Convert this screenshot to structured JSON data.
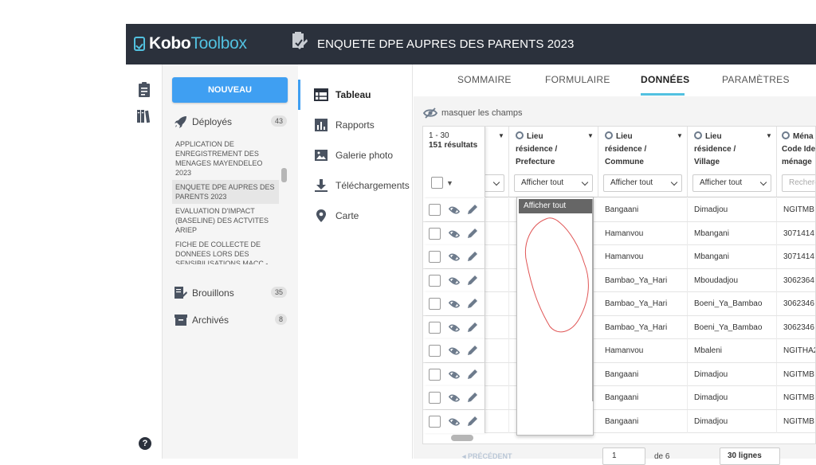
{
  "header": {
    "logo_kobo": "Kobo",
    "logo_toolbox": "Toolbox",
    "form_title": "ENQUETE  DPE AUPRES DES PARENTS 2023"
  },
  "sidebar": {
    "new_button": "NOUVEAU",
    "deployed": {
      "label": "Déployés",
      "count": "43"
    },
    "projects": [
      "APPLICATION DE ENREGISTREMENT DES MENAGES MAYENDELEO 2023",
      "ENQUETE DPE AUPRES DES PARENTS 2023",
      "EVALUATION D'IMPACT (BASELINE) DES ACTVITES ARIEP",
      "FICHE DE COLLECTE DE DONNEES LORS DES SENSIBILISATIONS MACC - ..."
    ],
    "drafts": {
      "label": "Brouillons",
      "count": "35"
    },
    "archived": {
      "label": "Archivés",
      "count": "8"
    }
  },
  "subnav": {
    "table": "Tableau",
    "reports": "Rapports",
    "gallery": "Galerie photo",
    "downloads": "Téléchargements",
    "map": "Carte"
  },
  "tabs": {
    "summary": "SOMMAIRE",
    "form": "FORMULAIRE",
    "data": "DONNÉES",
    "settings": "PARAMÈTRES"
  },
  "toolbar": {
    "hide_fields": "masquer les champs"
  },
  "table": {
    "range": "1 - 30",
    "results": "151 résultats",
    "columns": [
      {
        "label_lines": [
          "Lieu",
          "résidence /",
          "Prefecture"
        ],
        "filter": "Afficher tout"
      },
      {
        "label_lines": [
          "Lieu",
          "résidence /",
          "Commune"
        ],
        "filter": "Afficher tout"
      },
      {
        "label_lines": [
          "Lieu",
          "résidence /",
          "Village"
        ],
        "filter": "Afficher tout"
      },
      {
        "label_lines": [
          "Ména",
          "Code Ide",
          "ménage"
        ],
        "filter": "Recherc"
      }
    ],
    "rows": [
      [
        "Bangaani",
        "Dimadjou",
        "NGITMB"
      ],
      [
        "Hamanvou",
        "Mbangani",
        "3071414"
      ],
      [
        "Hamanvou",
        "Mbangani",
        "3071414"
      ],
      [
        "Bambao_Ya_Hari",
        "Mboudadjou",
        "3062364"
      ],
      [
        "Bambao_Ya_Hari",
        "Boeni_Ya_Bambao",
        "3062346"
      ],
      [
        "Bambao_Ya_Hari",
        "Boeni_Ya_Bambao",
        "3062346"
      ],
      [
        "Hamanvou",
        "Mbaleni",
        "NGITHA2"
      ],
      [
        "Bangaani",
        "Dimadjou",
        "NGITMB"
      ],
      [
        "Bangaani",
        "Dimadjou",
        "NGITMB"
      ],
      [
        "Bangaani",
        "Dimadjou",
        "NGITMB"
      ]
    ]
  },
  "dropdown": {
    "selected": "Afficher tout"
  },
  "pager": {
    "previous": "◂ PRÉCÉDENT",
    "page": "1",
    "of": "de 6",
    "size": "30 lignes"
  },
  "colors": {
    "topbar": "#2b313c",
    "accent": "#3f9ff2",
    "logo": "#52c1e0",
    "scribble": "#e05555"
  }
}
